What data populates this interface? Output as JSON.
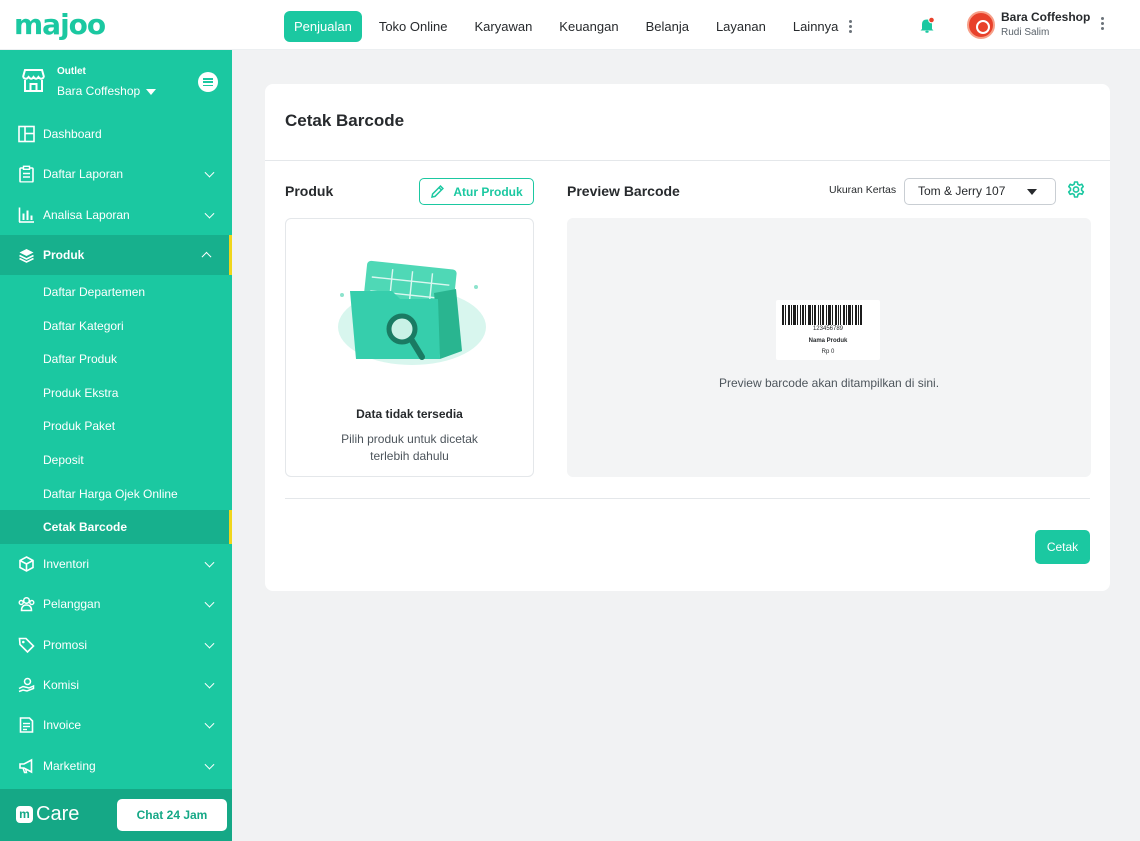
{
  "brand": {
    "logo_text": "majoo",
    "accent": "#1bc8a1",
    "highlight": "#f0d61b"
  },
  "topnav": {
    "items": [
      {
        "label": "Penjualan",
        "active": true
      },
      {
        "label": "Toko Online"
      },
      {
        "label": "Karyawan"
      },
      {
        "label": "Keuangan"
      },
      {
        "label": "Belanja"
      },
      {
        "label": "Layanan"
      },
      {
        "label": "Lainnya"
      }
    ],
    "more_icon": "kebab-vertical-icon",
    "notification_icon": "bell-icon"
  },
  "user": {
    "business_name": "Bara Coffeshop",
    "user_name": "Rudi Salim",
    "menu_icon": "kebab-vertical-icon"
  },
  "sidebar": {
    "outlet_label": "Outlet",
    "outlet_name": "Bara Coffeshop",
    "items": [
      {
        "label": "Dashboard",
        "icon": "dashboard-icon"
      },
      {
        "label": "Daftar Laporan",
        "icon": "clipboard-icon",
        "expandable": true
      },
      {
        "label": "Analisa Laporan",
        "icon": "bar-chart-icon",
        "expandable": true
      },
      {
        "label": "Produk",
        "icon": "box-icon",
        "expandable": true,
        "open": true,
        "children": [
          {
            "label": "Daftar Departemen"
          },
          {
            "label": "Daftar Kategori"
          },
          {
            "label": "Daftar Produk"
          },
          {
            "label": "Produk Ekstra"
          },
          {
            "label": "Produk Paket"
          },
          {
            "label": "Deposit"
          },
          {
            "label": "Daftar Harga Ojek Online"
          },
          {
            "label": "Cetak Barcode",
            "active": true
          }
        ]
      },
      {
        "label": "Inventori",
        "icon": "cube-icon",
        "expandable": true
      },
      {
        "label": "Pelanggan",
        "icon": "users-icon",
        "expandable": true
      },
      {
        "label": "Promosi",
        "icon": "tag-icon",
        "expandable": true
      },
      {
        "label": "Komisi",
        "icon": "hand-coin-icon",
        "expandable": true
      },
      {
        "label": "Invoice",
        "icon": "invoice-icon",
        "expandable": true
      },
      {
        "label": "Marketing",
        "icon": "megaphone-icon",
        "expandable": true
      }
    ],
    "care": {
      "logo_text": "Care",
      "chat_button": "Chat 24 Jam"
    }
  },
  "page": {
    "title": "Cetak Barcode",
    "produk_section": {
      "title": "Produk",
      "atur_button": "Atur Produk",
      "empty_title": "Data tidak tersedia",
      "empty_desc": "Pilih produk untuk dicetak terlebih dahulu"
    },
    "preview_section": {
      "title": "Preview Barcode",
      "paper_size_label": "Ukuran Kertas",
      "paper_size_value": "Tom & Jerry 107",
      "sample_number": "123456789",
      "sample_name": "Nama Produk",
      "sample_price": "Rp 0",
      "preview_text": "Preview barcode akan ditampilkan di sini."
    },
    "print_button": "Cetak"
  }
}
